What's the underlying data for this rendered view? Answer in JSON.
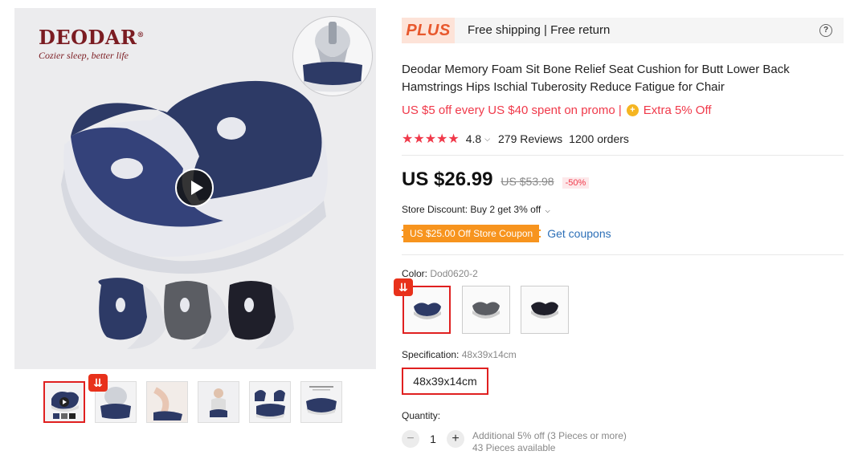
{
  "brand": {
    "name": "DEODAR",
    "tagline": "Cozier sleep, better life"
  },
  "plus_bar": {
    "logo": "PLUS",
    "text": "Free shipping | Free return",
    "help": "?"
  },
  "product": {
    "title": "Deodar Memory Foam Sit Bone Relief Seat Cushion for Butt Lower Back Hamstrings Hips Ischial Tuberosity Reduce Fatigue for Chair",
    "promo": "US $5 off every US $40 spent on promo |",
    "extra": "Extra 5% Off",
    "rating": "4.8",
    "rating_value": 4.8,
    "reviews": "279 Reviews",
    "orders": "1200 orders",
    "price": "US $26.99",
    "old_price": "US $53.98",
    "discount": "-50%",
    "store_discount": "Store Discount: Buy 2 get 3% off",
    "coupon": "US $25.00 Off Store Coupon",
    "get_coupons": "Get coupons"
  },
  "color": {
    "label": "Color:",
    "value": "Dod0620-2"
  },
  "spec": {
    "label": "Specification:",
    "value": "48x39x14cm",
    "option": "48x39x14cm"
  },
  "quantity": {
    "label": "Quantity:",
    "value": "1",
    "minus": "−",
    "plus": "+",
    "note1": "Additional 5% off (3 Pieces or more)",
    "note2": "43 Pieces available"
  },
  "colors": {
    "accent": "#f0394a",
    "navy": "#2d3a66",
    "coupon": "#f7941e",
    "link": "#2c6fb7"
  }
}
